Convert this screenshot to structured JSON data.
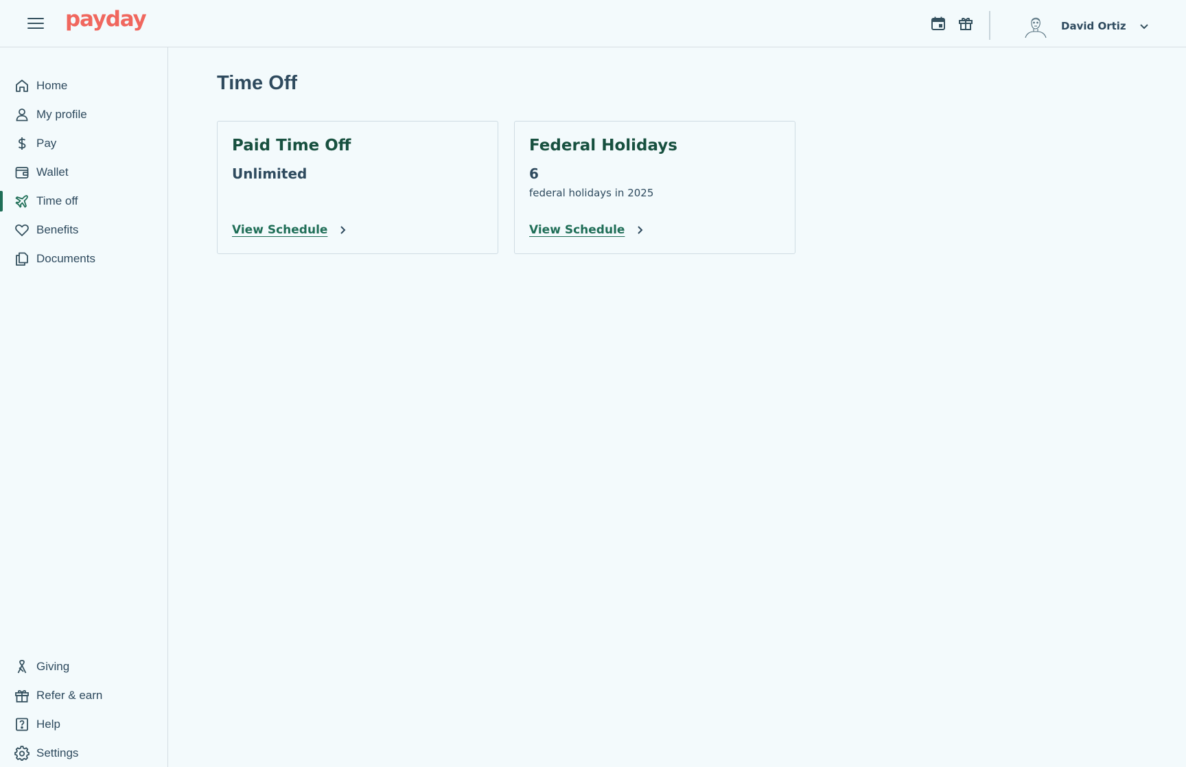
{
  "app": {
    "logo_text": "payday",
    "brand_color": "#f0675e",
    "accent_color": "#1f6e57"
  },
  "header": {
    "menu_icon": "hamburger-menu-icon",
    "calendar_icon": "calendar-icon",
    "gift_icon": "gift-icon",
    "user_name": "David Ortiz",
    "dropdown_icon": "chevron-down-icon"
  },
  "sidebar": {
    "items": [
      {
        "label": "Home",
        "icon": "home-icon"
      },
      {
        "label": "My profile",
        "icon": "user-icon"
      },
      {
        "label": "Pay",
        "icon": "dollar-icon"
      },
      {
        "label": "Wallet",
        "icon": "wallet-icon"
      },
      {
        "label": "Time off",
        "icon": "plane-icon",
        "active": true
      },
      {
        "label": "Benefits",
        "icon": "heart-icon"
      },
      {
        "label": "Documents",
        "icon": "documents-icon"
      }
    ],
    "bottom_items": [
      {
        "label": "Giving",
        "icon": "ribbon-icon"
      },
      {
        "label": "Refer & earn",
        "icon": "gift-icon"
      },
      {
        "label": "Help",
        "icon": "help-icon"
      },
      {
        "label": "Settings",
        "icon": "gear-icon"
      }
    ]
  },
  "main": {
    "title": "Time Off",
    "cards": [
      {
        "title": "Paid Time Off",
        "value": "Unlimited",
        "subtitle": "",
        "link_label": "View Schedule"
      },
      {
        "title": "Federal Holidays",
        "value": "6",
        "subtitle": "federal holidays in 2025",
        "link_label": "View Schedule"
      }
    ]
  }
}
